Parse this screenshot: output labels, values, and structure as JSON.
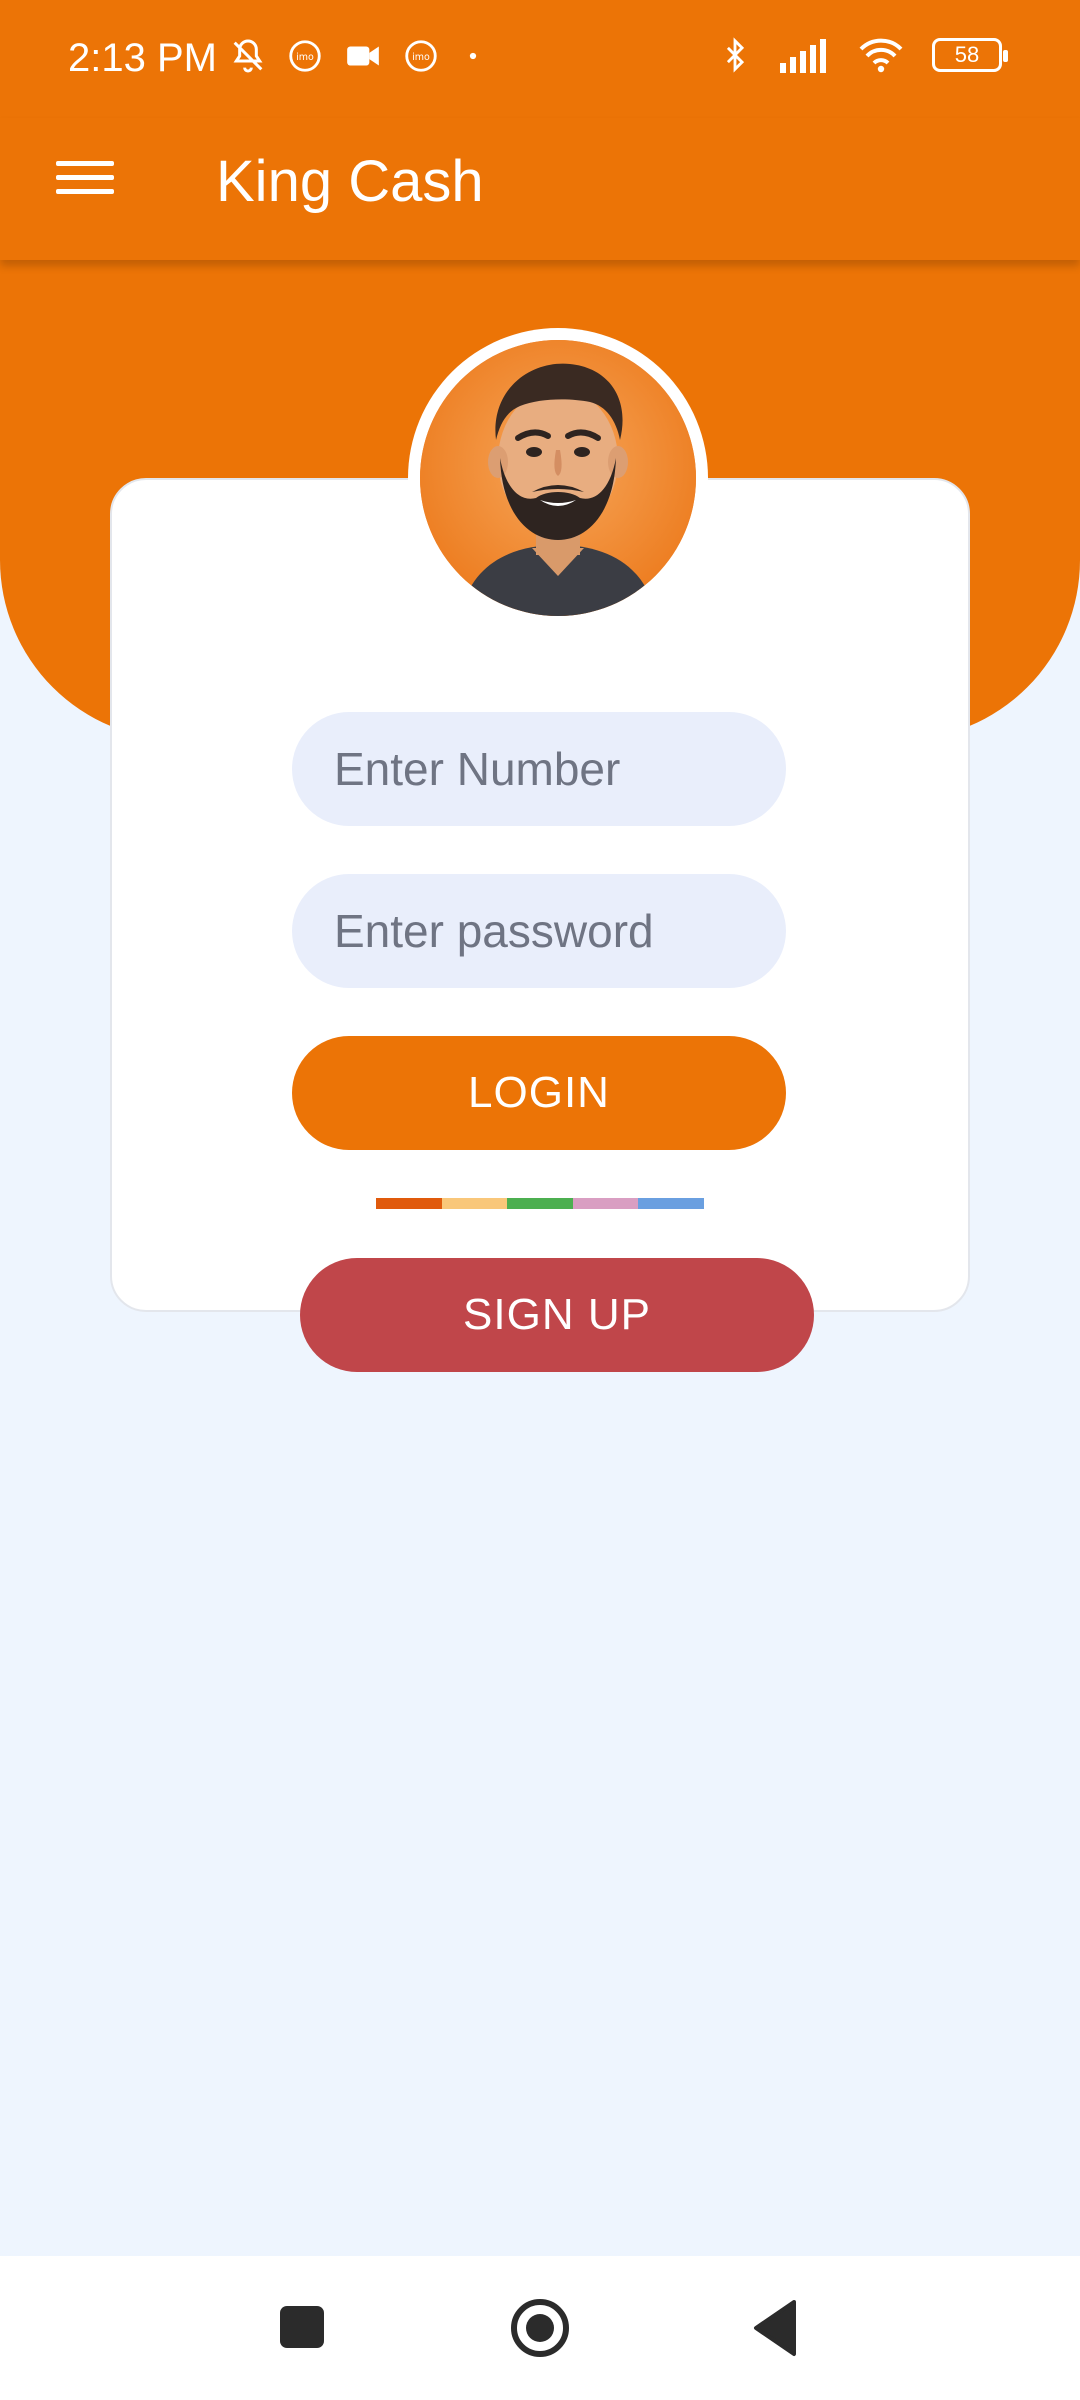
{
  "status_bar": {
    "time": "2:13 PM",
    "battery": "58",
    "icons": [
      "bell-off-icon",
      "imo-icon",
      "video-camera-icon",
      "imo-icon",
      "dot-icon",
      "bluetooth-icon",
      "signal-icon",
      "wifi-icon",
      "battery-icon"
    ]
  },
  "app_bar": {
    "title": "King Cash",
    "menu_icon": "hamburger-menu-icon"
  },
  "avatar": {
    "icon": "bearded-man-avatar"
  },
  "form": {
    "number_placeholder": "Enter Number",
    "password_placeholder": "Enter password",
    "login_label": "LOGIN",
    "signup_label": "SIGN UP"
  },
  "divider_colors": [
    "#e05a0c",
    "#f9c77a",
    "#4caf50",
    "#d99ec2",
    "#6a9fe0"
  ],
  "nav_bar": {
    "icons": [
      "recent-apps-icon",
      "home-icon",
      "back-icon"
    ]
  },
  "colors": {
    "primary": "#ec7406",
    "signup": "#c0464a",
    "background": "#eef5fe",
    "input_bg": "#e9eefb"
  }
}
